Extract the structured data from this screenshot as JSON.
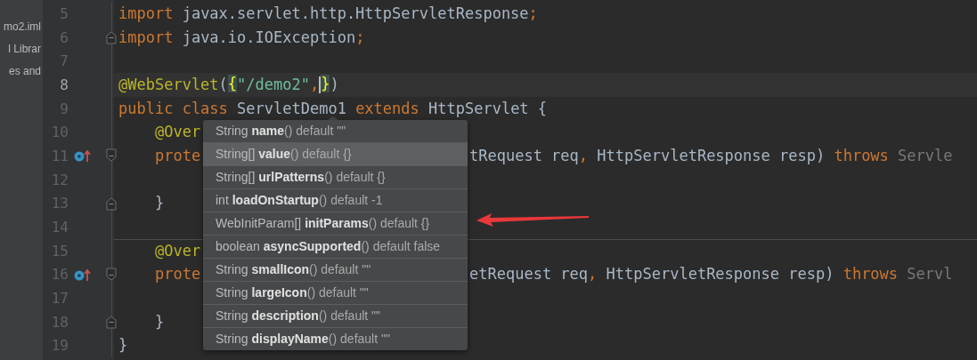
{
  "project_panel": {
    "items": [
      {
        "label": "mo2.iml"
      },
      {
        "label": "l Librar"
      },
      {
        "label": "es and"
      }
    ]
  },
  "editor": {
    "lines": [
      {
        "number": "5",
        "current": false,
        "override_marker": false,
        "separator_above": false,
        "left": [
          {
            "t": "import",
            "kind": "keyword"
          },
          {
            "t": " javax.servlet.http.HttpServletResponse",
            "kind": "plain"
          },
          {
            "t": ";",
            "kind": "punct"
          }
        ]
      },
      {
        "number": "6",
        "current": false,
        "override_marker": false,
        "separator_above": false,
        "fold": {
          "kind": "end"
        },
        "left": [
          {
            "t": "import",
            "kind": "keyword"
          },
          {
            "t": " java.io.IOException",
            "kind": "plain"
          },
          {
            "t": ";",
            "kind": "punct"
          }
        ]
      },
      {
        "number": "7",
        "current": false,
        "override_marker": false,
        "separator_above": false
      },
      {
        "number": "8",
        "current": true,
        "override_marker": false,
        "separator_above": false,
        "left": [
          {
            "t": "@WebServlet",
            "kind": "annotation"
          },
          {
            "t": "(",
            "kind": "plain"
          },
          {
            "t": "{",
            "kind": "brace"
          },
          {
            "t": "\"/demo2\"",
            "kind": "string"
          },
          {
            "t": ",",
            "kind": "punct"
          },
          {
            "kind": "caret"
          },
          {
            "t": "}",
            "kind": "brace"
          },
          {
            "t": ")",
            "kind": "plain"
          }
        ]
      },
      {
        "number": "9",
        "current": false,
        "override_marker": false,
        "separator_above": false,
        "left": [
          {
            "t": "public class",
            "kind": "keyword"
          },
          {
            "t": " ServletDemo1 ",
            "kind": "plain"
          },
          {
            "t": "extends",
            "kind": "keyword"
          },
          {
            "t": " HttpServlet {",
            "kind": "plain"
          }
        ]
      },
      {
        "number": "10",
        "current": false,
        "override_marker": false,
        "separator_above": false,
        "left": [
          {
            "t": "    @Over",
            "kind": "annotation"
          }
        ]
      },
      {
        "number": "11",
        "current": false,
        "override_marker": true,
        "separator_above": false,
        "fold": {
          "kind": "start"
        },
        "left": [
          {
            "t": "    prote",
            "kind": "keyword"
          }
        ],
        "right": [
          {
            "t": "tRequest req",
            "kind": "plain"
          },
          {
            "t": ",",
            "kind": "punct"
          },
          {
            "t": " HttpServletResponse resp) ",
            "kind": "plain"
          },
          {
            "t": "throws",
            "kind": "keyword"
          },
          {
            "t": " Servle",
            "kind": "gray"
          }
        ]
      },
      {
        "number": "12",
        "current": false,
        "override_marker": false,
        "separator_above": false
      },
      {
        "number": "13",
        "current": false,
        "override_marker": false,
        "separator_above": false,
        "fold": {
          "kind": "end"
        },
        "left": [
          {
            "t": "    }",
            "kind": "plain"
          }
        ]
      },
      {
        "number": "14",
        "current": false,
        "override_marker": false,
        "separator_above": false
      },
      {
        "number": "15",
        "current": false,
        "override_marker": false,
        "separator_above": true,
        "left": [
          {
            "t": "    @Over",
            "kind": "annotation"
          }
        ]
      },
      {
        "number": "16",
        "current": false,
        "override_marker": true,
        "separator_above": false,
        "fold": {
          "kind": "start"
        },
        "left": [
          {
            "t": "    prote",
            "kind": "keyword"
          }
        ],
        "right": [
          {
            "t": "etRequest req",
            "kind": "plain"
          },
          {
            "t": ",",
            "kind": "punct"
          },
          {
            "t": " HttpServletResponse resp) ",
            "kind": "plain"
          },
          {
            "t": "throws",
            "kind": "keyword"
          },
          {
            "t": " Servl",
            "kind": "gray"
          }
        ]
      },
      {
        "number": "17",
        "current": false,
        "override_marker": false,
        "separator_above": false
      },
      {
        "number": "18",
        "current": false,
        "override_marker": false,
        "separator_above": false,
        "fold": {
          "kind": "end"
        },
        "left": [
          {
            "t": "    }",
            "kind": "plain"
          }
        ]
      },
      {
        "number": "19",
        "current": false,
        "override_marker": false,
        "separator_above": false,
        "left": [
          {
            "t": "}",
            "kind": "plain"
          }
        ]
      }
    ]
  },
  "completion_popup": {
    "items": [
      {
        "type": "String",
        "name": "name",
        "suffix": "() default \"\"",
        "selected": false
      },
      {
        "type": "String[]",
        "name": "value",
        "suffix": "() default {}",
        "selected": true
      },
      {
        "type": "String[]",
        "name": "urlPatterns",
        "suffix": "() default {}",
        "selected": false
      },
      {
        "type": "int",
        "name": "loadOnStartup",
        "suffix": "() default -1",
        "selected": false
      },
      {
        "type": "WebInitParam[]",
        "name": "initParams",
        "suffix": "() default {}",
        "selected": false
      },
      {
        "type": "boolean",
        "name": "asyncSupported",
        "suffix": "() default false",
        "selected": false
      },
      {
        "type": "String",
        "name": "smallIcon",
        "suffix": "() default \"\"",
        "selected": false
      },
      {
        "type": "String",
        "name": "largeIcon",
        "suffix": "() default \"\"",
        "selected": false
      },
      {
        "type": "String",
        "name": "description",
        "suffix": "() default \"\"",
        "selected": false
      },
      {
        "type": "String",
        "name": "displayName",
        "suffix": "() default \"\"",
        "selected": false
      }
    ]
  }
}
